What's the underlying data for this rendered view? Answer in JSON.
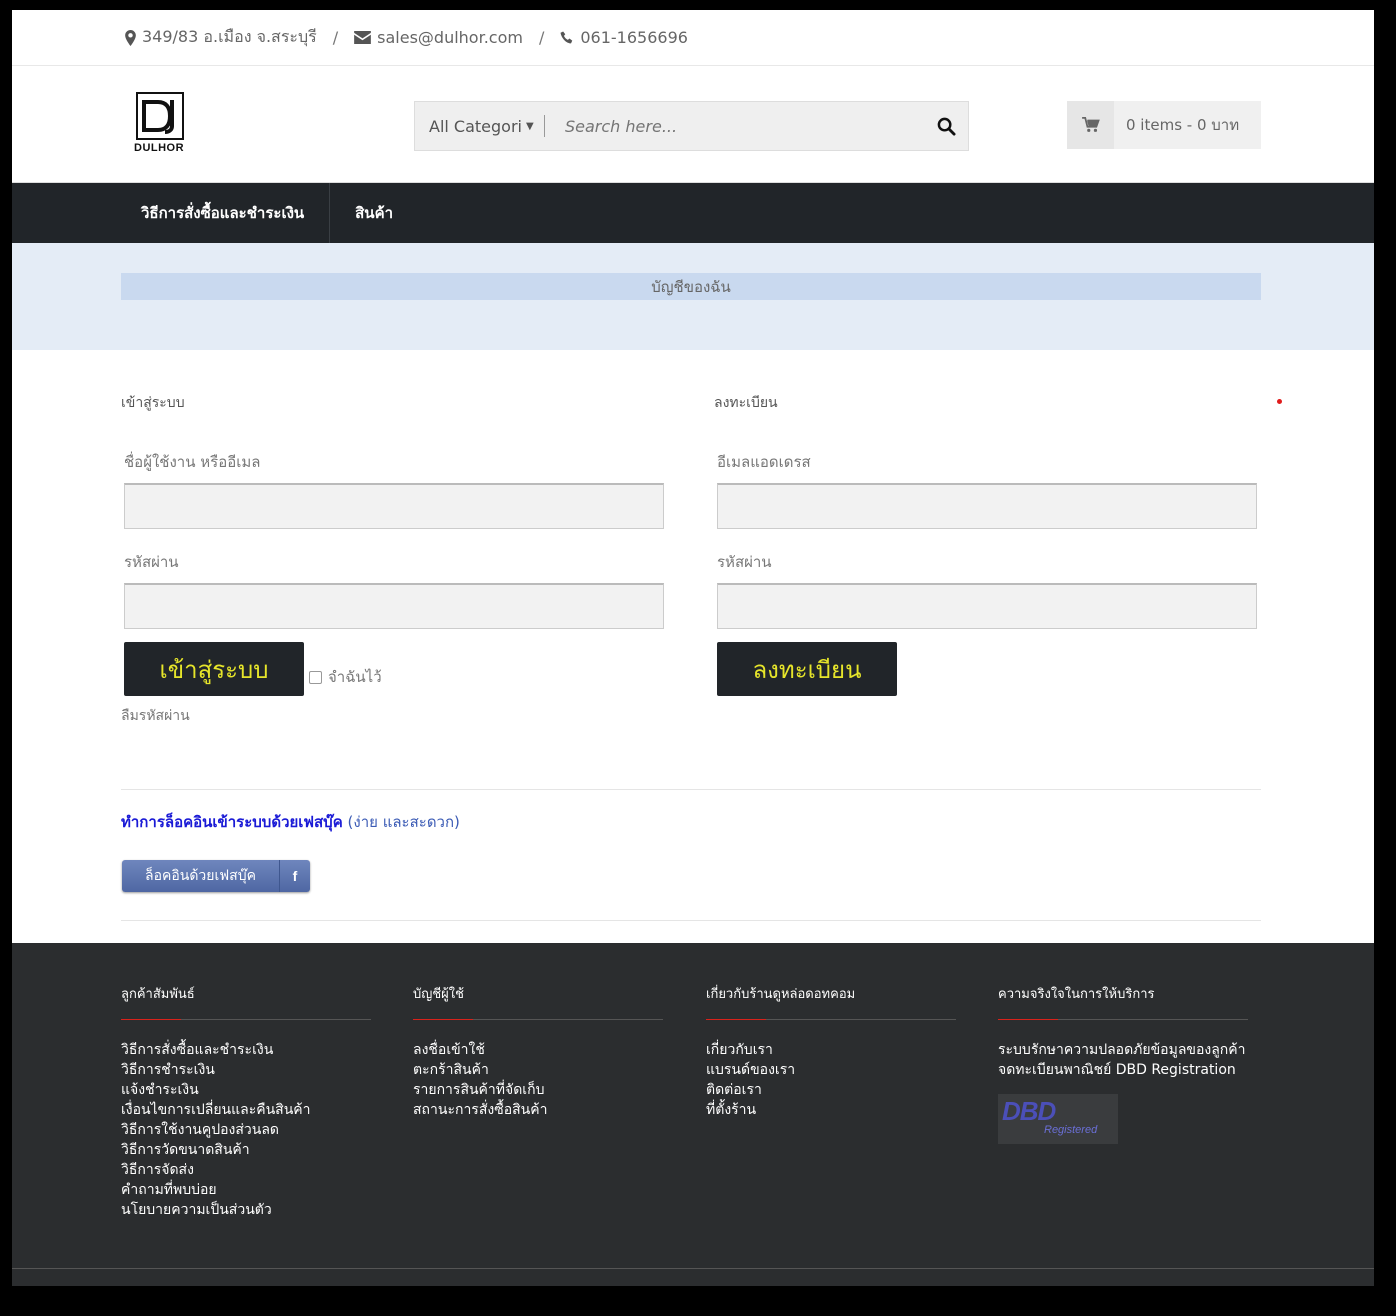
{
  "topbar": {
    "address": "349/83 อ.เมือง จ.สระบุรี",
    "email": "sales@dulhor.com",
    "phone": "061-1656696",
    "separator": "/"
  },
  "header": {
    "logo_text": "DULHOR",
    "search": {
      "category": "All Categori",
      "placeholder": "Search here..."
    },
    "cart": {
      "summary": "0 items - 0 บาท"
    }
  },
  "nav": {
    "items": [
      {
        "label": "วิธีการสั่งซื้อและชำระเงิน"
      },
      {
        "label": "สินค้า"
      }
    ]
  },
  "banner": {
    "title": "บัญชีของฉัน"
  },
  "login": {
    "title": "เข้าสู่ระบบ",
    "username_label": "ชื่อผู้ใช้งาน หรืออีเมล",
    "password_label": "รหัสผ่าน",
    "submit": "เข้าสู่ระบบ",
    "remember": "จำฉันไว้",
    "forgot": "ลืมรหัสผ่าน"
  },
  "register": {
    "title": "ลงทะเบียน",
    "email_label": "อีเมลแอดเดรส",
    "password_label": "รหัสผ่าน",
    "submit": "ลงทะเบียน"
  },
  "facebook": {
    "prompt_strong": "ทำการล็อคอินเข้าระบบด้วยเฟสบุ๊ค",
    "prompt_soft": "(ง่าย และสะดวก)",
    "button": "ล็อคอินด้วยเฟสบุ๊ค",
    "button_icon": "f"
  },
  "footer": {
    "columns": [
      {
        "heading": "ลูกค้าสัมพันธ์",
        "links": [
          "วิธีการสั่งซื้อและชำระเงิน",
          "วิธีการชำระเงิน",
          "แจ้งชำระเงิน",
          "เงื่อนไขการเปลี่ยนและคืนสินค้า",
          "วิธีการใช้งานคูปองส่วนลด",
          "วิธีการวัดขนาดสินค้า",
          "วิธีการจัดส่ง",
          "คำถามที่พบบ่อย",
          "นโยบายความเป็นส่วนตัว"
        ]
      },
      {
        "heading": "บัญชีผู้ใช้",
        "links": [
          "ลงชื่อเข้าใช้",
          "ตะกร้าสินค้า",
          "รายการสินค้าที่จัดเก็บ",
          "สถานะการสั่งซื้อสินค้า"
        ]
      },
      {
        "heading": "เกี่ยวกับร้านดูหล่อดอทคอม",
        "links": [
          "เกี่ยวกับเรา",
          "แบรนด์ของเรา",
          "ติดต่อเรา",
          "ที่ตั้งร้าน"
        ]
      },
      {
        "heading": "ความจริงใจในการให้บริการ",
        "links": [
          "ระบบรักษาความปลอดภัยข้อมูลของลูกค้า",
          "จดทะเบียนพาณิชย์ DBD Registration"
        ],
        "badge_main": "DBD",
        "badge_sub": "Registered"
      }
    ]
  },
  "colors": {
    "nav_bg": "#212529",
    "button_text": "#e6e52a",
    "banner_bg": "#e4ecf6",
    "footer_bg": "#2b2d2f",
    "accent_red": "#d9221b"
  }
}
